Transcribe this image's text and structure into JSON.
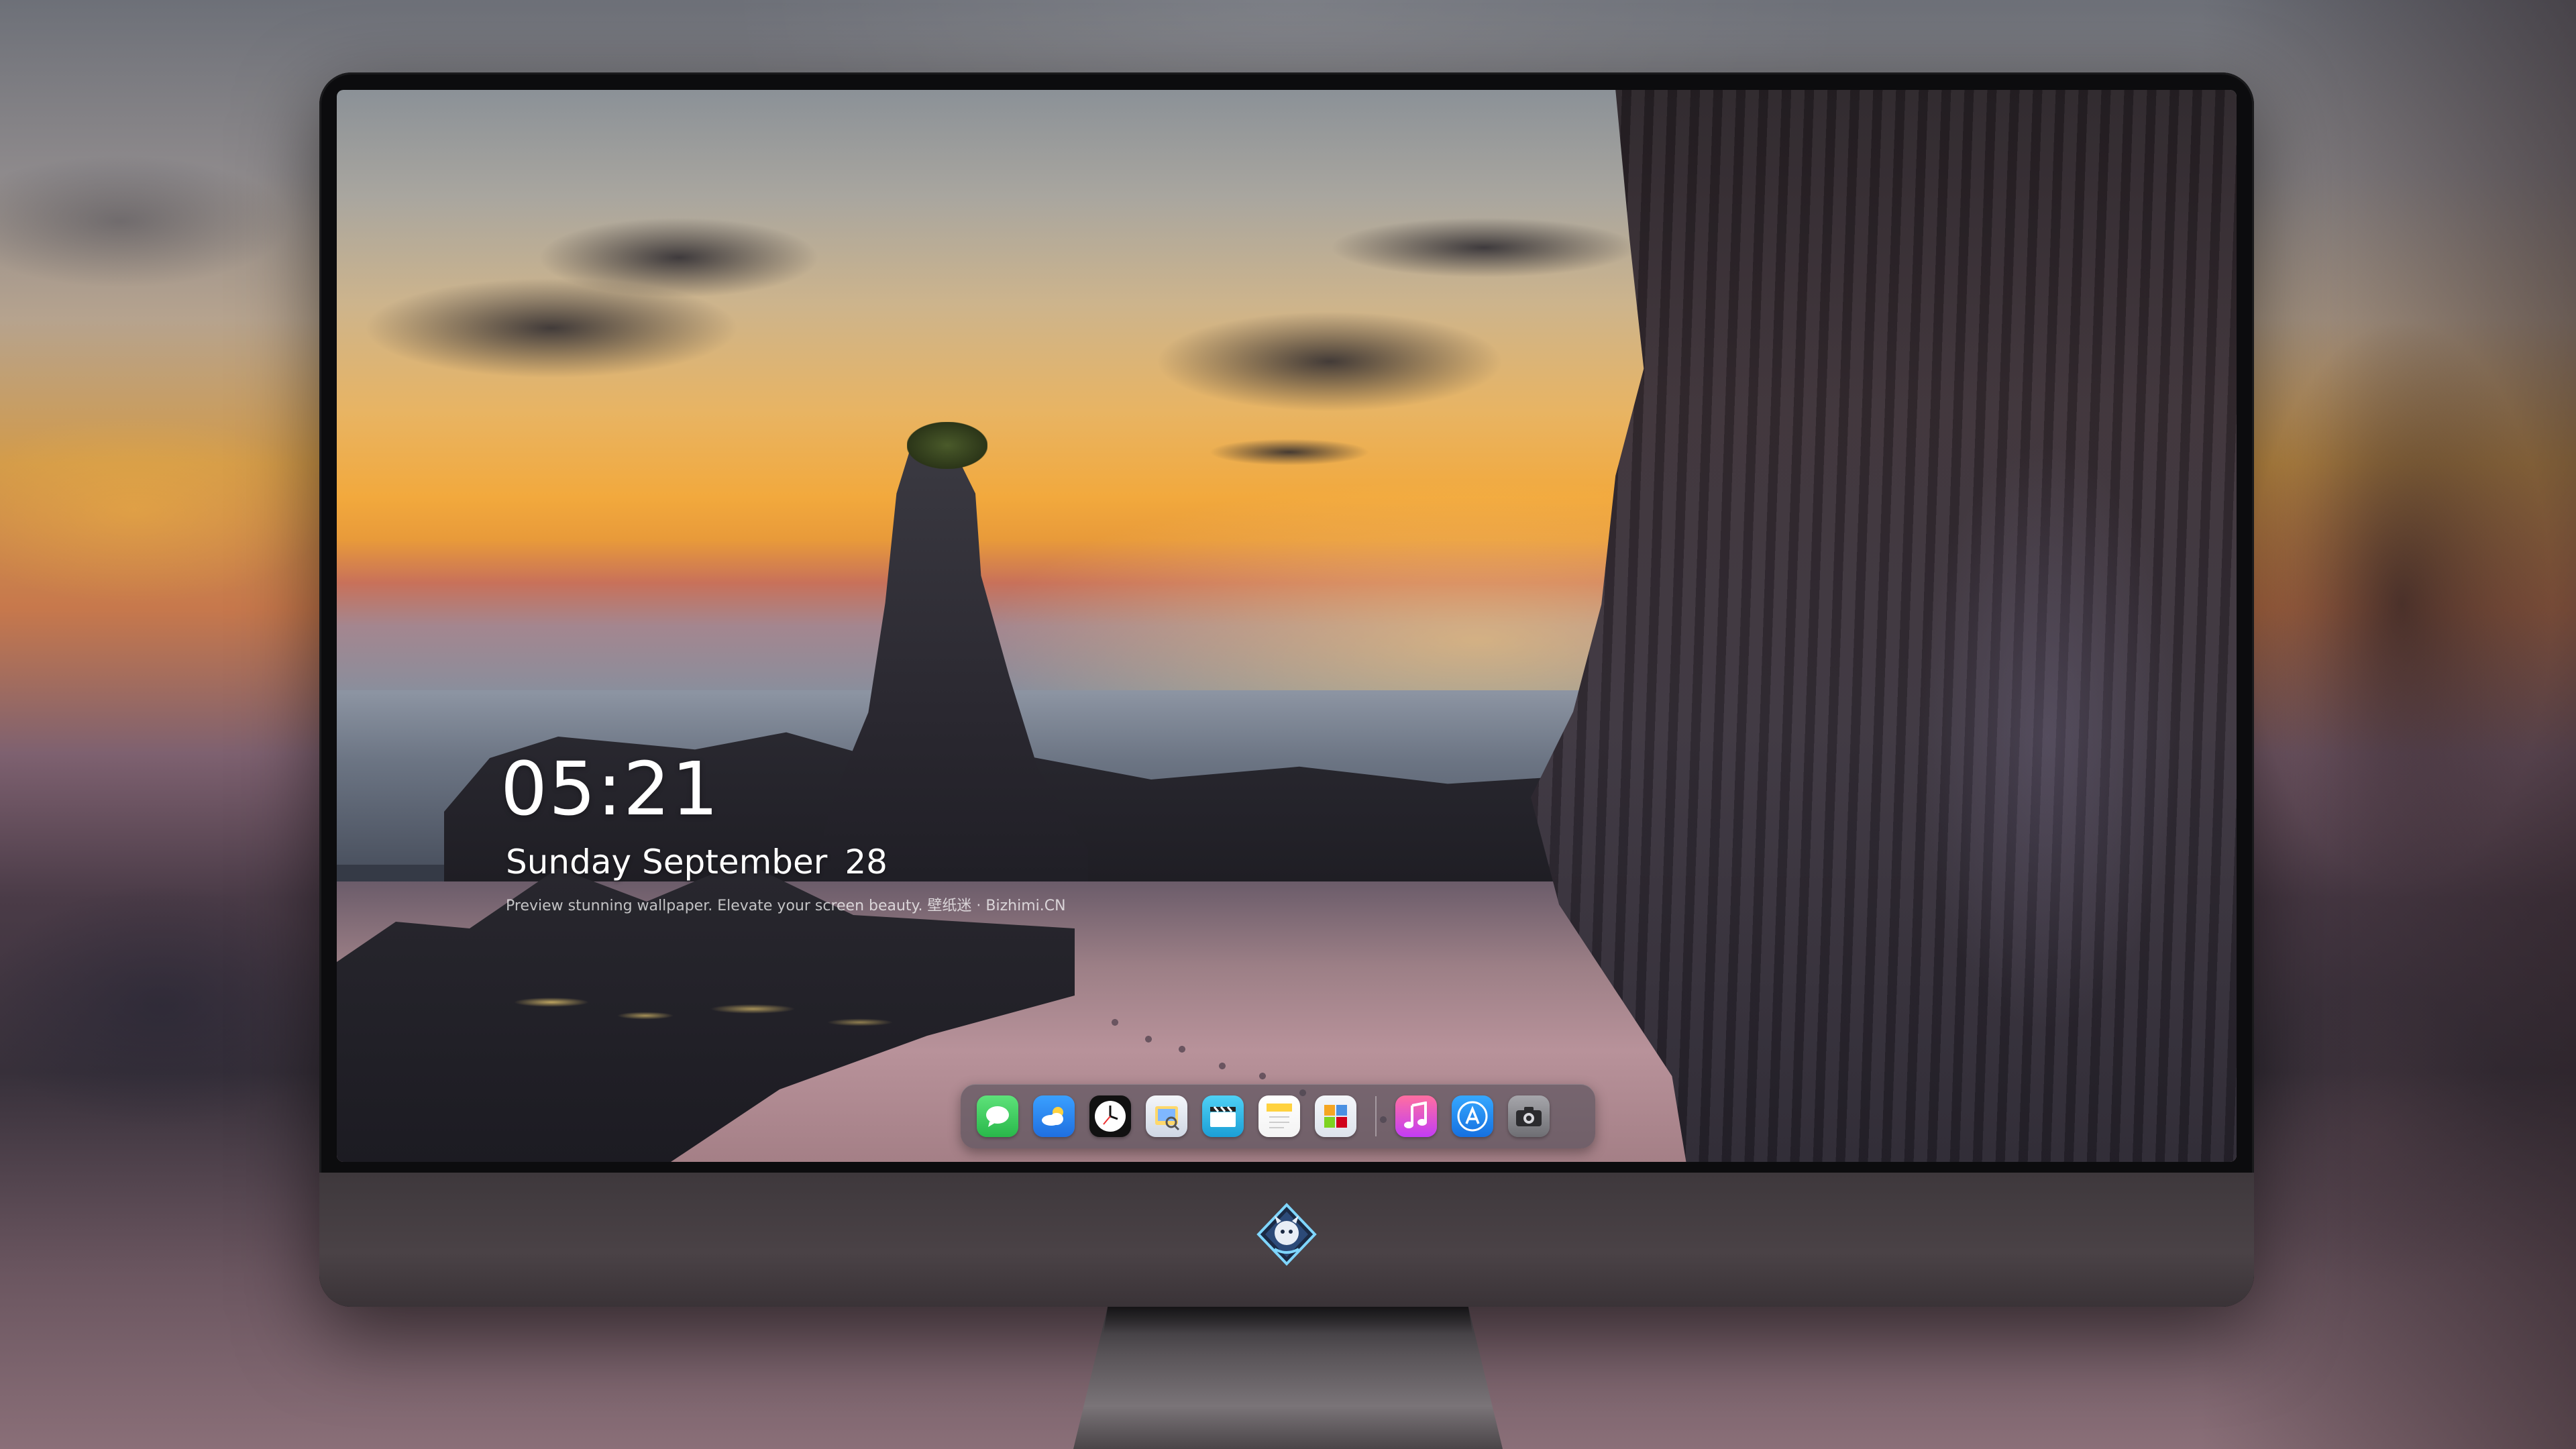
{
  "lock_screen": {
    "time": "05:21",
    "date_day": "Sunday September",
    "date_num": "28",
    "caption": "Preview stunning wallpaper. Elevate your screen beauty. 壁纸迷 · Bizhimi.CN"
  },
  "dock": {
    "apps": [
      {
        "name": "Messages",
        "icon": "message-bubble-icon",
        "color": "#34c759"
      },
      {
        "name": "Weather",
        "icon": "cloud-sun-icon",
        "color": "#2f8cf0"
      },
      {
        "name": "Clock",
        "icon": "clock-icon",
        "color": "#111111"
      },
      {
        "name": "Preview",
        "icon": "preview-icon",
        "color": "#e8edf5"
      },
      {
        "name": "Claquette",
        "icon": "clapperboard-icon",
        "color": "#23b5e8"
      },
      {
        "name": "Notes",
        "icon": "notes-icon",
        "color": "#ffd23f"
      },
      {
        "name": "Photo Slideshow",
        "icon": "photo-grid-icon",
        "color": "#e9eef5"
      },
      {
        "name": "Music",
        "icon": "music-note-icon",
        "color": "#fb5c74"
      },
      {
        "name": "App Store",
        "icon": "app-store-icon",
        "color": "#1e90ff"
      },
      {
        "name": "Camera",
        "icon": "camera-icon",
        "color": "#8e8e93"
      }
    ]
  },
  "colors": {
    "accent": "#ffffff",
    "bezel": "#0c0c0e",
    "chin": "#4a4246"
  }
}
